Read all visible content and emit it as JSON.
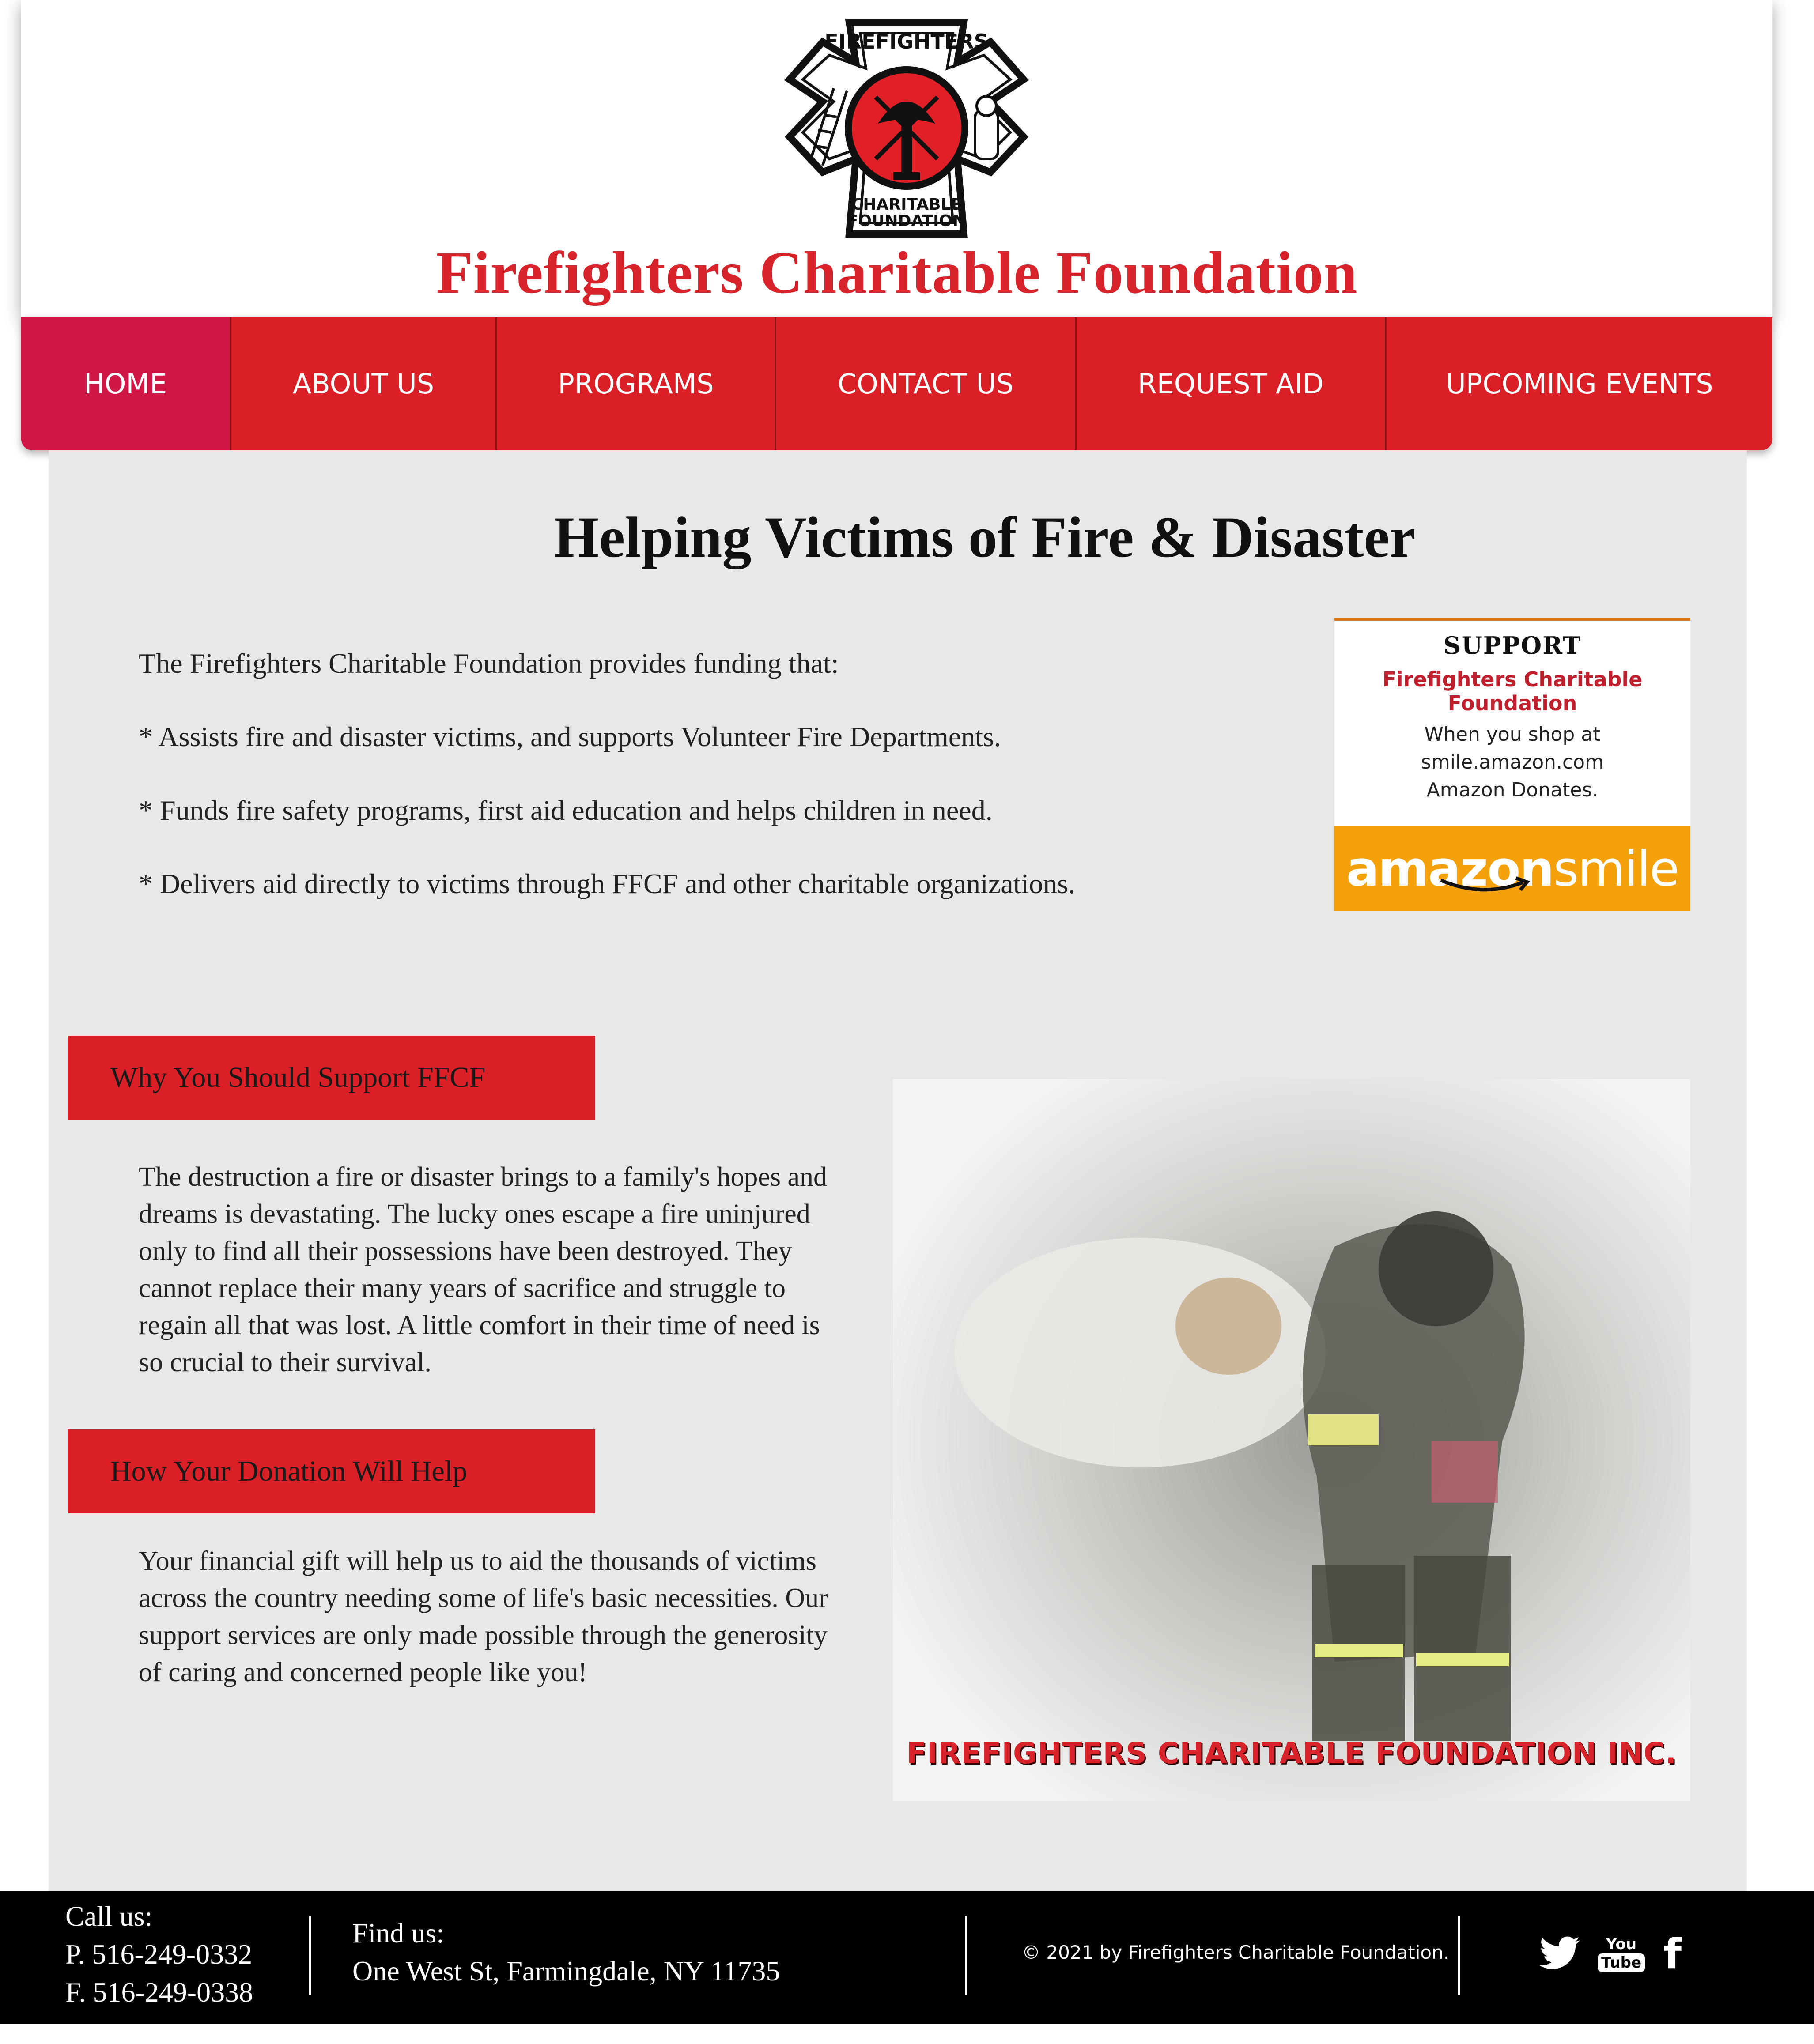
{
  "header": {
    "logo": {
      "top_text": "FIREFIGHTERS",
      "bottom_text_1": "CHARITABLE",
      "bottom_text_2": "FOUNDATION",
      "icon": "maltese-cross-logo"
    },
    "title": "Firefighters Charitable Foundation"
  },
  "nav": {
    "items": [
      {
        "label": "HOME",
        "active": true
      },
      {
        "label": "ABOUT US"
      },
      {
        "label": "PROGRAMS"
      },
      {
        "label": "CONTACT US"
      },
      {
        "label": "REQUEST AID"
      },
      {
        "label": "UPCOMING EVENTS"
      }
    ]
  },
  "main": {
    "headline": "Helping Victims of Fire & Disaster",
    "intro": [
      "The Firefighters Charitable Foundation provides funding that:",
      "* Assists fire and disaster victims, and supports Volunteer Fire Departments.",
      "* Funds fire safety programs, first aid education and helps children in need.",
      "* Delivers aid directly to victims through FFCF and other charitable organizations."
    ],
    "amazon_card": {
      "support": "SUPPORT",
      "org": "Firefighters Charitable Foundation",
      "line1": "When you shop at",
      "line2": "smile.amazon.com",
      "line3": "Amazon Donates.",
      "logo_bold": "amazon",
      "logo_light": "smile"
    },
    "section1": {
      "heading": "Why You Should Support FFCF",
      "body": "The destruction a fire or disaster brings to a family's hopes and dreams is devastating. The lucky ones escape a fire uninjured only to find all their possessions have been destroyed. They cannot replace their many years of sacrifice and struggle to regain all that was lost. A little comfort in their time of need is so crucial to their survival."
    },
    "section2": {
      "heading": "How Your Donation Will Help",
      "body": "Your financial gift will help us to aid the thousands of victims across the country needing some of life's basic necessities. Our support services are only made possible through the generosity of caring and concerned people like you!"
    },
    "photo_caption": "FIREFIGHTERS CHARITABLE FOUNDATION INC."
  },
  "footer": {
    "call_title": "Call us:",
    "phone": "P.  516-249-0332",
    "fax": "F.  516-249-0338",
    "find_title": "Find us:",
    "address": "One West St, Farmingdale, NY 11735",
    "copyright": "© 2021 by Firefighters Charitable Foundation.",
    "social": [
      {
        "icon": "twitter-icon"
      },
      {
        "icon": "youtube-icon",
        "text_top": "You",
        "text_bottom": "Tube"
      },
      {
        "icon": "facebook-icon",
        "glyph": "f"
      }
    ]
  },
  "colors": {
    "brand_red": "#da1f26",
    "active_nav": "#cf1644",
    "amazon_orange": "#f5a10c",
    "background": "#e8e8e8"
  }
}
